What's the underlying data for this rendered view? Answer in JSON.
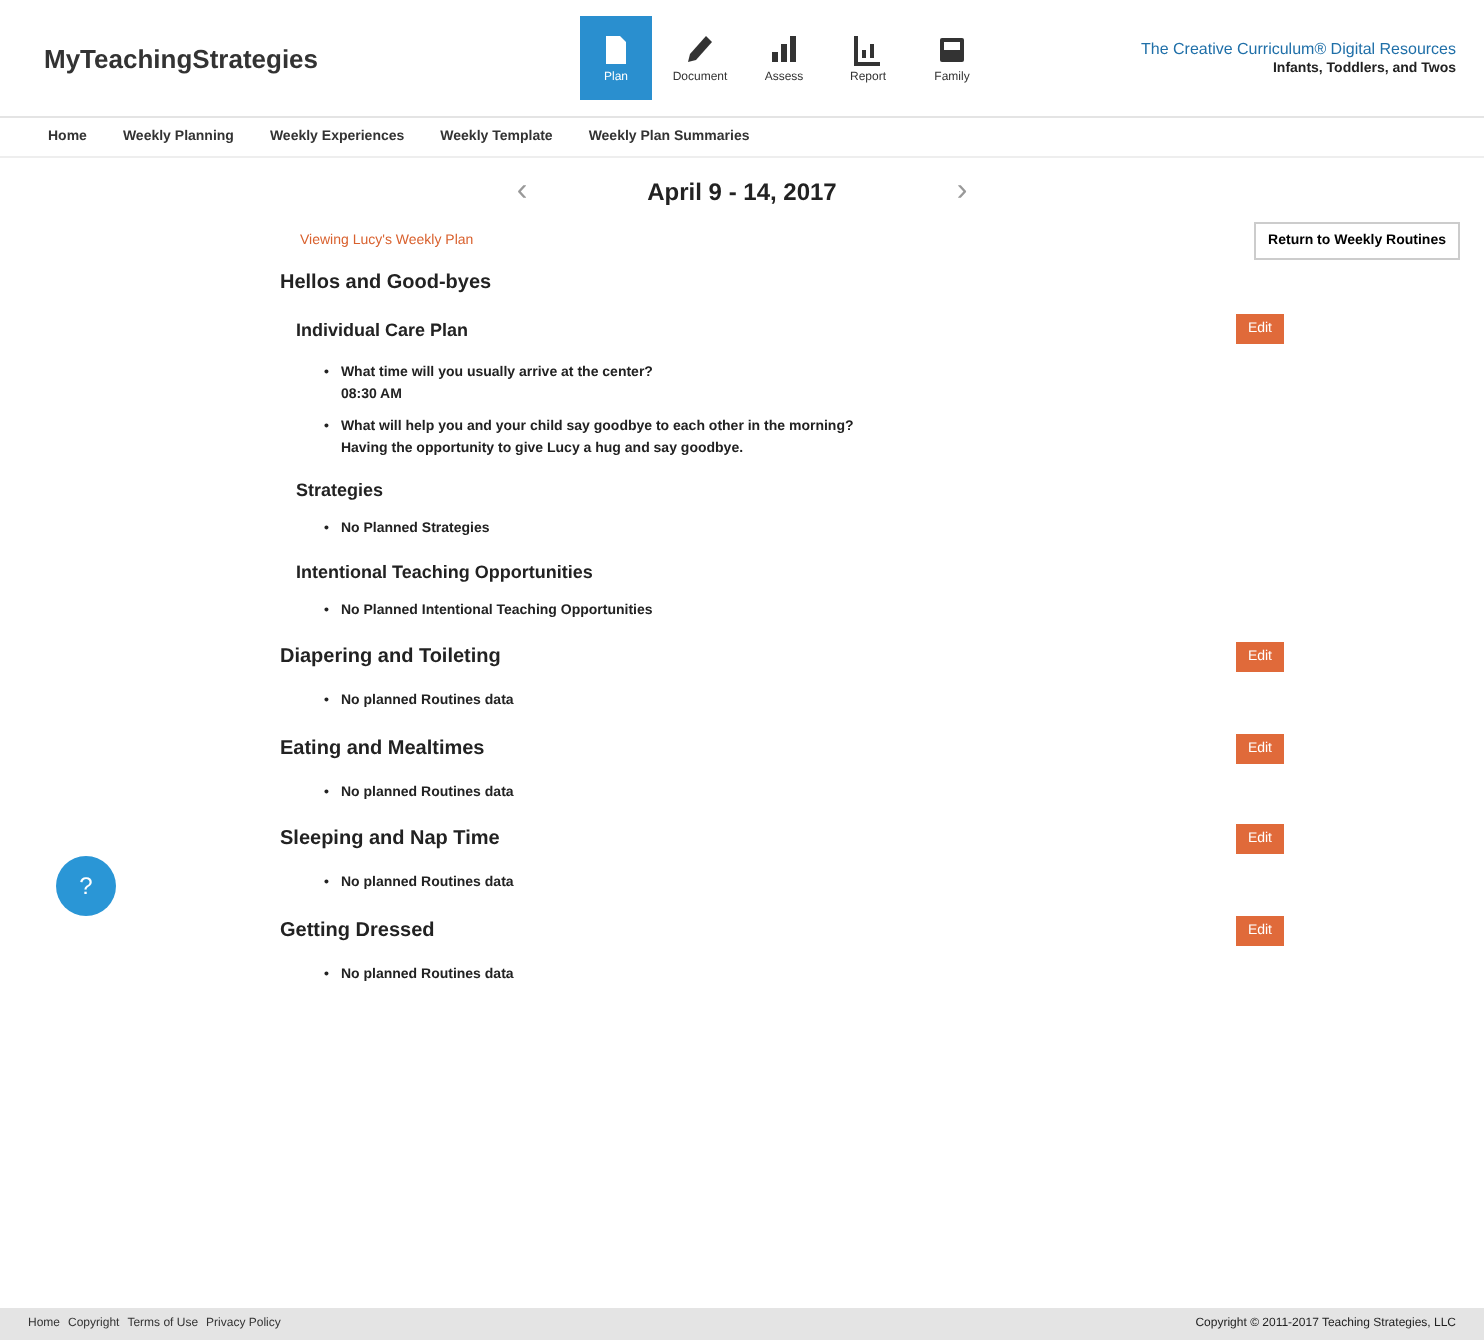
{
  "header": {
    "logo": "MyTeachingStrategies",
    "nav": [
      {
        "label": "Plan",
        "kind": "plan",
        "selected": true
      },
      {
        "label": "Document",
        "kind": "pencil",
        "selected": false
      },
      {
        "label": "Assess",
        "kind": "bars",
        "selected": false
      },
      {
        "label": "Report",
        "kind": "chart",
        "selected": false
      },
      {
        "label": "Family",
        "kind": "tablet",
        "selected": false
      }
    ],
    "product": "The Creative Curriculum® Digital Resources",
    "product_subtitle": "Infants, Toddlers, and Twos"
  },
  "subnav": [
    "Home",
    "Weekly Planning",
    "Weekly Experiences",
    "Weekly Template",
    "Weekly Plan Summaries"
  ],
  "week": {
    "prev": "‹",
    "title": "April 9 - 14, 2017",
    "next": "›"
  },
  "plan_link": "Viewing Lucy's Weekly Plan",
  "return_button": "Return to Weekly Routines",
  "sections": [
    {
      "title": "Hellos and Good-byes",
      "groups": [
        {
          "title": "Individual Care Plan",
          "edit": "Edit",
          "items": [
            {
              "bullet": "•",
              "text": "What time will you usually arrive at the center?",
              "answer": "08:30 AM"
            },
            {
              "bullet": "•",
              "text": "What will help you and your child say goodbye to each other in the morning?",
              "answer": "Having the opportunity to give Lucy a hug and say goodbye."
            }
          ]
        },
        {
          "title": "Strategies",
          "items": [
            {
              "bullet": "•",
              "text": "No Planned Strategies"
            }
          ]
        },
        {
          "title": "Intentional Teaching Opportunities",
          "items": [
            {
              "bullet": "•",
              "text": "No Planned Intentional Teaching Opportunities"
            }
          ]
        }
      ]
    },
    {
      "title": "Diapering and Toileting",
      "edit": "Edit",
      "items": [
        {
          "bullet": "•",
          "text": "No planned Routines data"
        }
      ]
    },
    {
      "title": "Eating and Mealtimes",
      "edit": "Edit",
      "items": [
        {
          "bullet": "•",
          "text": "No planned Routines data"
        }
      ]
    },
    {
      "title": "Sleeping and Nap Time",
      "edit": "Edit",
      "items": [
        {
          "bullet": "•",
          "text": "No planned Routines data"
        }
      ]
    },
    {
      "title": "Getting Dressed",
      "edit": "Edit",
      "items": [
        {
          "bullet": "•",
          "text": "No planned Routines data"
        }
      ]
    }
  ],
  "help": "?",
  "footer": {
    "links": [
      "Home",
      "Copyright",
      "Terms of Use",
      "Privacy Policy"
    ],
    "copyright": "Copyright © 2011-2017 Teaching Strategies, LLC"
  }
}
